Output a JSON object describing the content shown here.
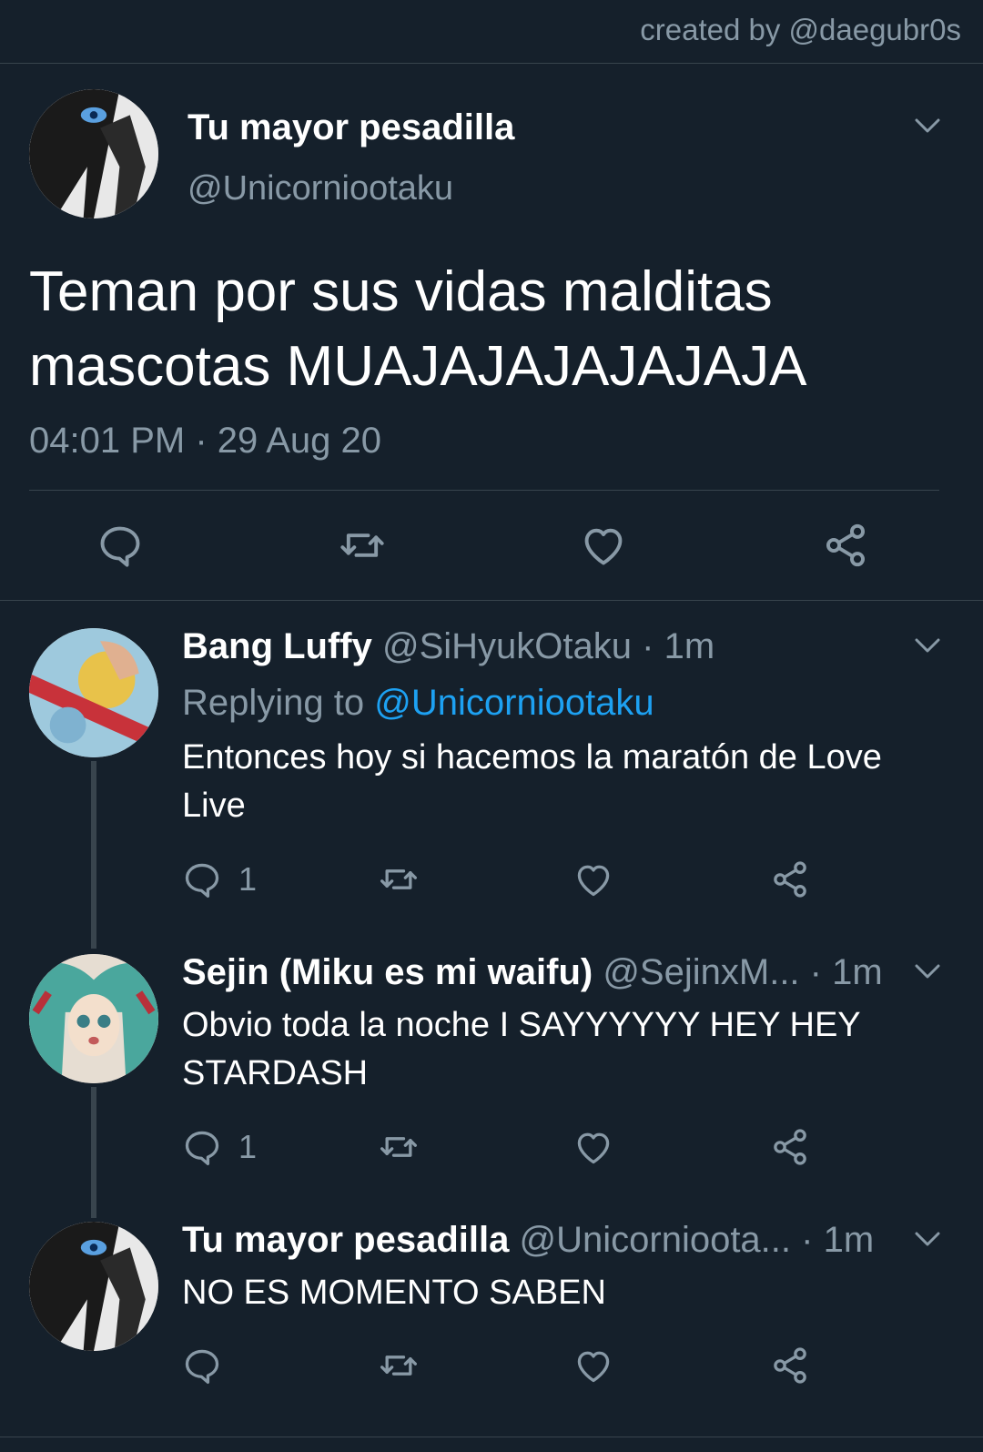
{
  "watermark": "created by @daegubr0s",
  "main_tweet": {
    "author_name": "Tu mayor pesadilla",
    "author_handle": "@Unicorniootaku",
    "text": "Teman por sus vidas malditas mascotas MUAJAJAJAJAJAJA",
    "time": "04:01 PM",
    "date": "29 Aug 20",
    "dot": "·"
  },
  "replies": [
    {
      "author_name": "Bang Luffy",
      "author_handle": "@SiHyukOtaku",
      "dot": "·",
      "time": "1m",
      "replying_label": "Replying to",
      "replying_to": "@Unicorniootaku",
      "text": "Entonces hoy si hacemos la maratón de Love Live",
      "reply_count": "1"
    },
    {
      "author_name": "Sejin (Miku es mi waifu)",
      "author_handle": "@SejinxM...",
      "dot": "·",
      "time": "1m",
      "text": "Obvio toda la noche I SAYYYYYY HEY HEY STARDASH",
      "reply_count": "1"
    },
    {
      "author_name": "Tu mayor pesadilla",
      "author_handle": "@Unicornioota...",
      "dot": "·",
      "time": "1m",
      "text": "NO ES MOMENTO SABEN",
      "reply_count": ""
    }
  ],
  "colors": {
    "background": "#15202b",
    "text_primary": "#ffffff",
    "text_secondary": "#8899a6",
    "link": "#1da1f2",
    "separator": "#38444d"
  }
}
